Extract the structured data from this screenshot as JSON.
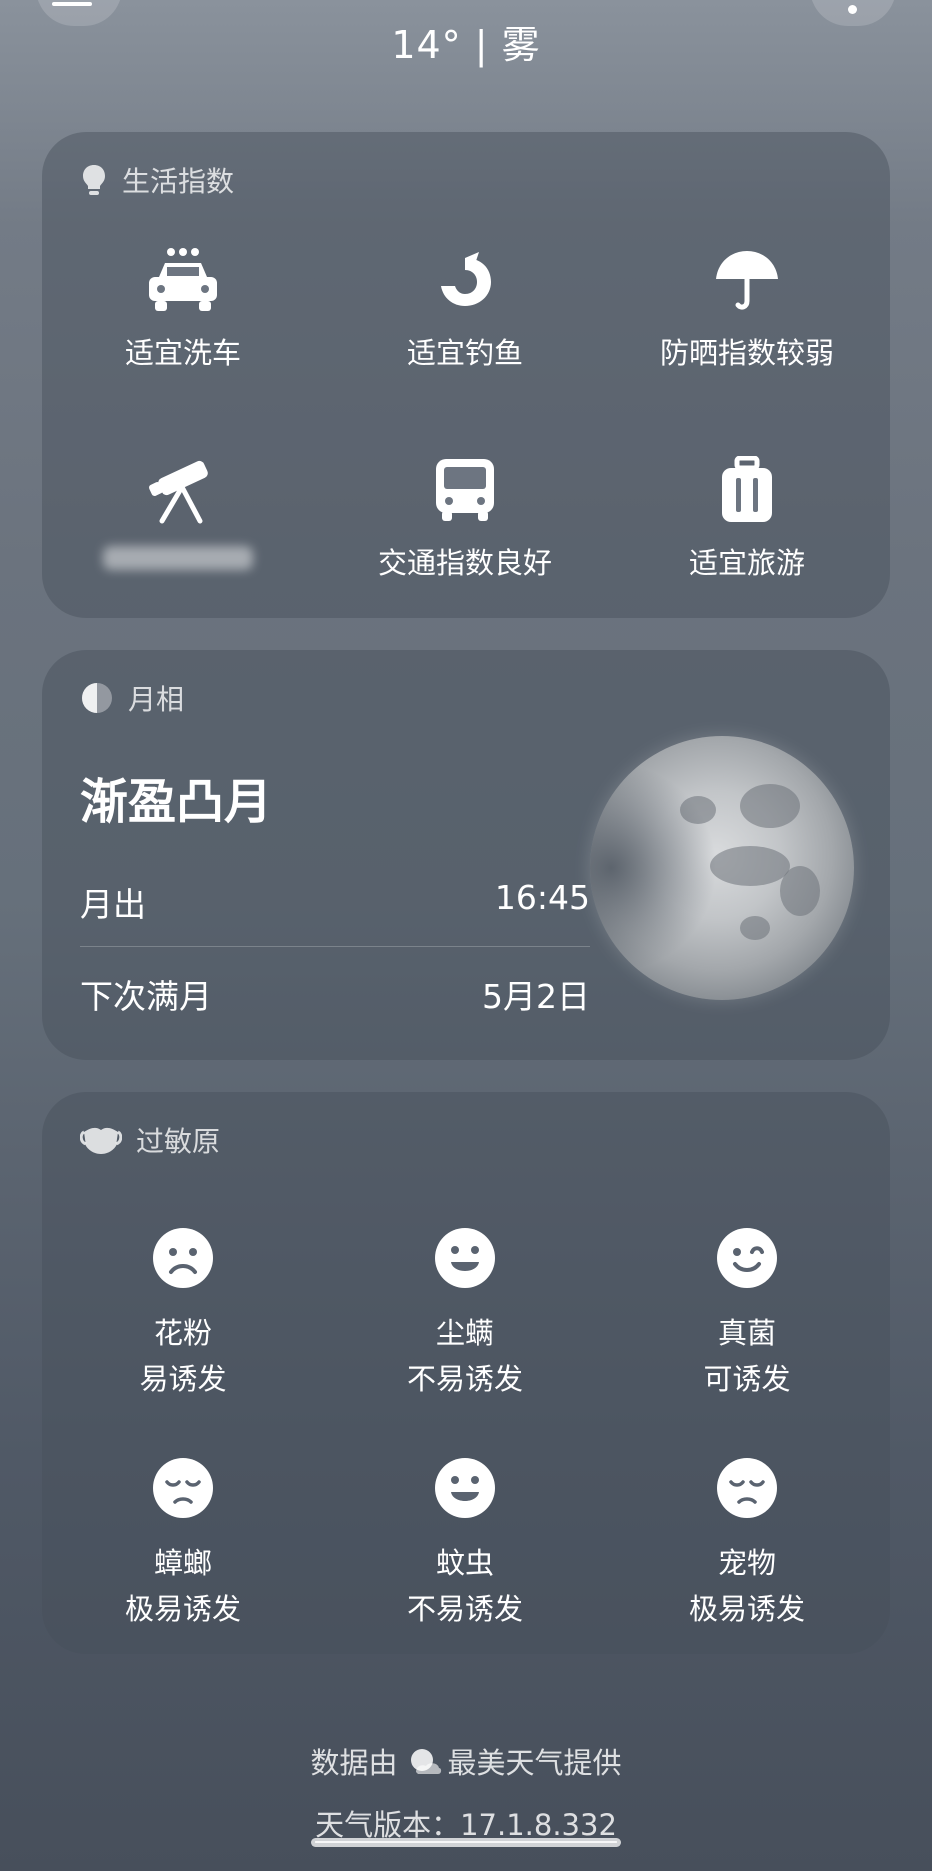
{
  "header": {
    "temperature": "14°",
    "separator": "|",
    "condition": "雾"
  },
  "life_index": {
    "title": "生活指数",
    "items": [
      {
        "icon": "car-wash-icon",
        "label": "适宜洗车"
      },
      {
        "icon": "fishing-icon",
        "label": "适宜钓鱼"
      },
      {
        "icon": "umbrella-icon",
        "label": "防晒指数较弱"
      },
      {
        "icon": "telescope-icon",
        "label": ""
      },
      {
        "icon": "bus-icon",
        "label": "交通指数良好"
      },
      {
        "icon": "luggage-icon",
        "label": "适宜旅游"
      }
    ]
  },
  "moon_phase": {
    "title": "月相",
    "phase": "渐盈凸月",
    "moonrise_label": "月出",
    "moonrise_value": "16:45",
    "next_full_label": "下次满月",
    "next_full_value": "5月2日"
  },
  "allergens": {
    "title": "过敏原",
    "items": [
      {
        "icon": "sad-face-icon",
        "name": "花粉",
        "level": "易诱发"
      },
      {
        "icon": "happy-face-icon",
        "name": "尘螨",
        "level": "不易诱发"
      },
      {
        "icon": "wink-face-icon",
        "name": "真菌",
        "level": "可诱发"
      },
      {
        "icon": "unhappy-face-icon",
        "name": "蟑螂",
        "level": "极易诱发"
      },
      {
        "icon": "happy-face-icon",
        "name": "蚊虫",
        "level": "不易诱发"
      },
      {
        "icon": "unhappy-face-icon",
        "name": "宠物",
        "level": "极易诱发"
      }
    ]
  },
  "footer": {
    "source_prefix": "数据由",
    "source_name": "最美天气提供",
    "version": "天气版本：17.1.8.332"
  }
}
